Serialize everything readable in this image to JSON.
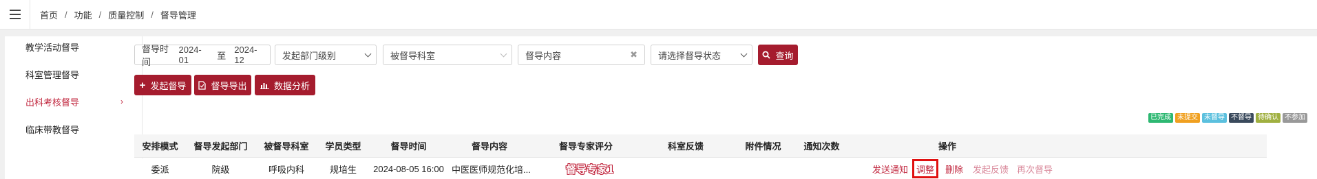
{
  "breadcrumb": [
    "首页",
    "功能",
    "质量控制",
    "督导管理"
  ],
  "sidebar": {
    "items": [
      {
        "label": "教学活动督导",
        "active": false
      },
      {
        "label": "科室管理督导",
        "active": false
      },
      {
        "label": "出科考核督导",
        "active": true
      },
      {
        "label": "临床带教督导",
        "active": false
      }
    ]
  },
  "filters": {
    "time_label": "督导时间",
    "time_start": "2024-01",
    "time_sep": "至",
    "time_end": "2024-12",
    "dept_level": "发起部门级别",
    "target_dept": "被督导科室",
    "content_placeholder": "督导内容",
    "status_placeholder": "请选择督导状态",
    "query_label": "查询"
  },
  "actions": {
    "start": "发起督导",
    "export": "督导导出",
    "analyze": "数据分析"
  },
  "legend": [
    {
      "label": "已完成",
      "color": "#2eb872"
    },
    {
      "label": "未提交",
      "color": "#f0a020"
    },
    {
      "label": "未督导",
      "color": "#5bc0de"
    },
    {
      "label": "不督导",
      "color": "#3a4a5c"
    },
    {
      "label": "待确认",
      "color": "#a0b040"
    },
    {
      "label": "不参加",
      "color": "#999999"
    }
  ],
  "table": {
    "headers": [
      "安排模式",
      "督导发起部门",
      "被督导科室",
      "学员类型",
      "督导时间",
      "督导内容",
      "督导专家评分",
      "科室反馈",
      "附件情况",
      "通知次数",
      "操作"
    ],
    "rows": [
      {
        "mode": "委派",
        "dept": "院级",
        "target": "呼吸内科",
        "student_type": "规培生",
        "time": "2024-08-05 16:00",
        "content": "中医医师规范化培...",
        "expert": "督导专家1",
        "ops": [
          "发送通知",
          "调整",
          "删除",
          "发起反馈",
          "再次督导"
        ]
      }
    ]
  }
}
